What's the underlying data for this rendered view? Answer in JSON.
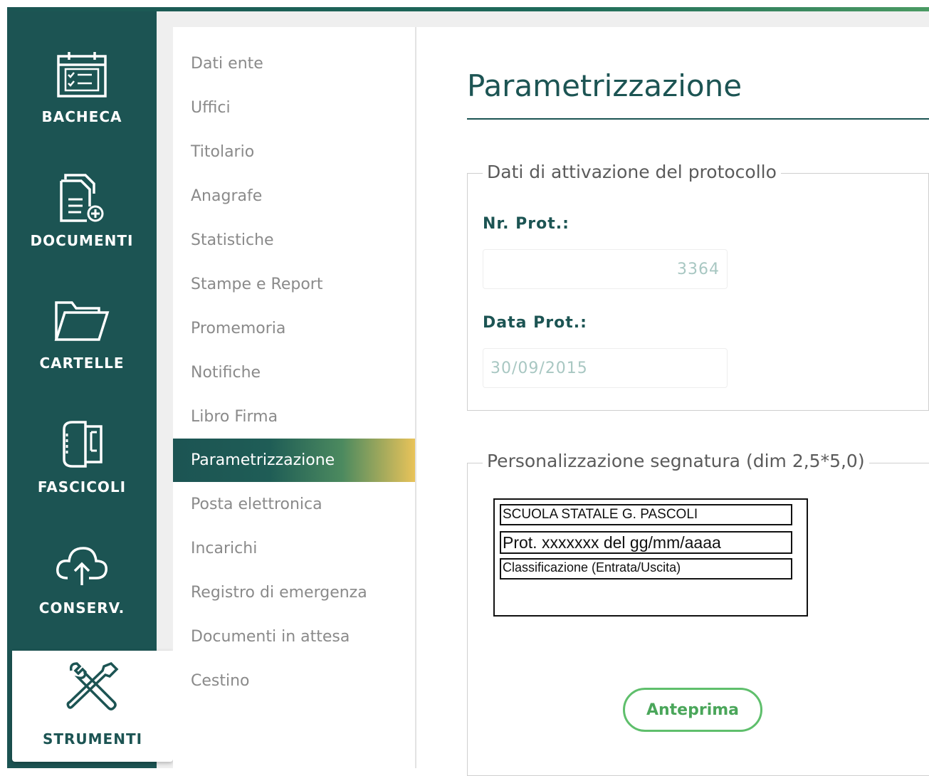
{
  "sidebar": {
    "items": [
      {
        "label": "BACHECA",
        "icon": "calendar-checklist-icon"
      },
      {
        "label": "DOCUMENTI",
        "icon": "document-add-icon"
      },
      {
        "label": "CARTELLE",
        "icon": "folder-open-icon"
      },
      {
        "label": "FASCICOLI",
        "icon": "binder-icon"
      },
      {
        "label": "CONSERV.",
        "icon": "cloud-upload-icon"
      },
      {
        "label": "STRUMENTI",
        "icon": "tools-icon",
        "active": true
      }
    ]
  },
  "submenu": {
    "items": [
      {
        "label": "Dati ente"
      },
      {
        "label": "Uffici"
      },
      {
        "label": "Titolario"
      },
      {
        "label": "Anagrafe"
      },
      {
        "label": "Statistiche"
      },
      {
        "label": "Stampe e Report"
      },
      {
        "label": "Promemoria"
      },
      {
        "label": "Notifiche"
      },
      {
        "label": "Libro Firma"
      },
      {
        "label": "Parametrizzazione",
        "active": true
      },
      {
        "label": "Posta elettronica"
      },
      {
        "label": "Incarichi"
      },
      {
        "label": "Registro di emergenza"
      },
      {
        "label": "Documenti in attesa"
      },
      {
        "label": "Cestino"
      }
    ]
  },
  "main": {
    "title": "Parametrizzazione",
    "activation": {
      "legend": "Dati di attivazione del protocollo",
      "nr_prot_label": "Nr. Prot.:",
      "nr_prot_value": "3364",
      "data_prot_label": "Data Prot.:",
      "data_prot_value": "30/09/2015"
    },
    "signature": {
      "legend": "Personalizzazione segnatura (dim 2,5*5,0)",
      "line1": "SCUOLA STATALE G. PASCOLI",
      "line2": "Prot. xxxxxxx del gg/mm/aaaa",
      "line3": "Classificazione (Entrata/Uscita)",
      "preview_label": "Anteprima"
    }
  },
  "colors": {
    "primary": "#1c5453",
    "accent_green": "#5fbf6c",
    "active_gradient_end": "#e9c35a"
  }
}
